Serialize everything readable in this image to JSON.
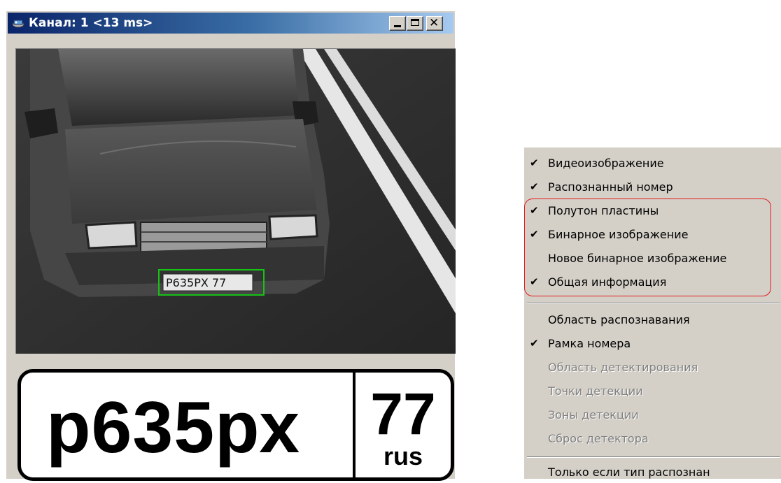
{
  "window": {
    "title": "Канал: 1 <13 ms>",
    "buttons": [
      "minimize",
      "maximize",
      "close"
    ],
    "close_glyph": "✕",
    "title_icon": "channel-icon"
  },
  "video": {
    "detected_plate_text": "P635PX 77",
    "detection_box_color": "#16c216"
  },
  "plate": {
    "number": "р635рх",
    "region": "77",
    "country": "rus"
  },
  "menu": {
    "group1": [
      {
        "label": "Видеоизображение",
        "checked": true,
        "check": "✔"
      },
      {
        "label": "Распознанный номер",
        "checked": true,
        "check": "✔"
      }
    ],
    "group2": [
      {
        "label": "Полутон пластины",
        "checked": true,
        "check": "✔"
      },
      {
        "label": "Бинарное изображение",
        "checked": true,
        "check": "✔"
      },
      {
        "label": "Новое бинарное изображение",
        "checked": false,
        "check": ""
      },
      {
        "label": "Общая информация",
        "checked": true,
        "check": "✔"
      }
    ],
    "group3": [
      {
        "label": "Область распознавания",
        "checked": false,
        "check": ""
      },
      {
        "label": "Рамка номера",
        "checked": true,
        "check": "✔"
      },
      {
        "label": "Область детектирования",
        "checked": false,
        "disabled": true,
        "check": ""
      },
      {
        "label": "Точки детекции",
        "checked": false,
        "disabled": true,
        "check": ""
      },
      {
        "label": "Зоны детекции",
        "checked": false,
        "disabled": true,
        "check": ""
      },
      {
        "label": "Сброс детектора",
        "checked": false,
        "disabled": true,
        "check": ""
      }
    ],
    "group4": [
      {
        "label": "Только если тип распознан",
        "checked": false,
        "check": ""
      }
    ],
    "highlight_color": "#e21a1a"
  }
}
